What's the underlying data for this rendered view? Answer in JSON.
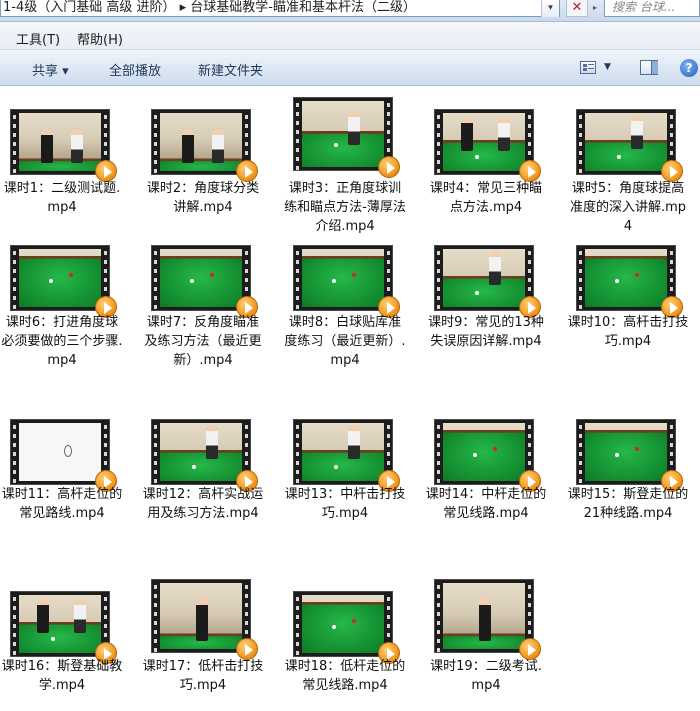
{
  "address": {
    "path": "1-4级（入门基础 高级 进阶） ▸ 台球基础教学-瞄准和基本杆法（二级）",
    "search_placeholder": "搜索 台球..."
  },
  "menu": {
    "tools": "工具(T)",
    "help": "帮助(H)"
  },
  "toolbar": {
    "share": "共享 ▾",
    "play_all": "全部播放",
    "new_folder": "新建文件夹"
  },
  "icons": {
    "close": "close-icon",
    "views": "view-options-icon",
    "preview_pane": "preview-pane-icon",
    "help": "help-icon",
    "play_badge": "play-badge-icon",
    "video_thumbnail": "video-thumbnail-icon"
  },
  "files": [
    {
      "label": "课时1：二级测试题.mp4",
      "scene": "room-2p"
    },
    {
      "label": "课时2：角度球分类讲解.mp4",
      "scene": "room-2p"
    },
    {
      "label": "课时3：正角度球训练和瞄点方法-薄厚法介绍.mp4",
      "scene": "table-1p"
    },
    {
      "label": "课时4：常见三种瞄点方法.mp4",
      "scene": "table-2p"
    },
    {
      "label": "课时5：角度球提高准度的深入讲解.mp4",
      "scene": "table-1p"
    },
    {
      "label": "课时6：打进角度球必须要做的三个步骤.mp4",
      "scene": "table-full"
    },
    {
      "label": "课时7：反角度瞄准及练习方法（最近更新）.mp4",
      "scene": "table-full"
    },
    {
      "label": "课时8：白球贴库准度练习（最近更新）.mp4",
      "scene": "table-full"
    },
    {
      "label": "课时9：常见的13种失误原因详解.mp4",
      "scene": "table-1p"
    },
    {
      "label": "课时10：高杆击打技巧.mp4",
      "scene": "table-full"
    },
    {
      "label": "课时11：高杆走位的常见路线.mp4",
      "scene": "white"
    },
    {
      "label": "课时12：高杆实战运用及练习方法.mp4",
      "scene": "table-1p"
    },
    {
      "label": "课时13：中杆击打技巧.mp4",
      "scene": "table-1p"
    },
    {
      "label": "课时14：中杆走位的常见线路.mp4",
      "scene": "table-full"
    },
    {
      "label": "课时15：斯登走位的21种线路.mp4",
      "scene": "table-full"
    },
    {
      "label": "课时16：斯登基础教学.mp4",
      "scene": "table-2p"
    },
    {
      "label": "课时17：低杆击打技巧.mp4",
      "scene": "room-1p"
    },
    {
      "label": "课时18：低杆走位的常见线路.mp4",
      "scene": "table-full"
    },
    {
      "label": "课时19：二级考试.mp4",
      "scene": "room-1p"
    }
  ]
}
